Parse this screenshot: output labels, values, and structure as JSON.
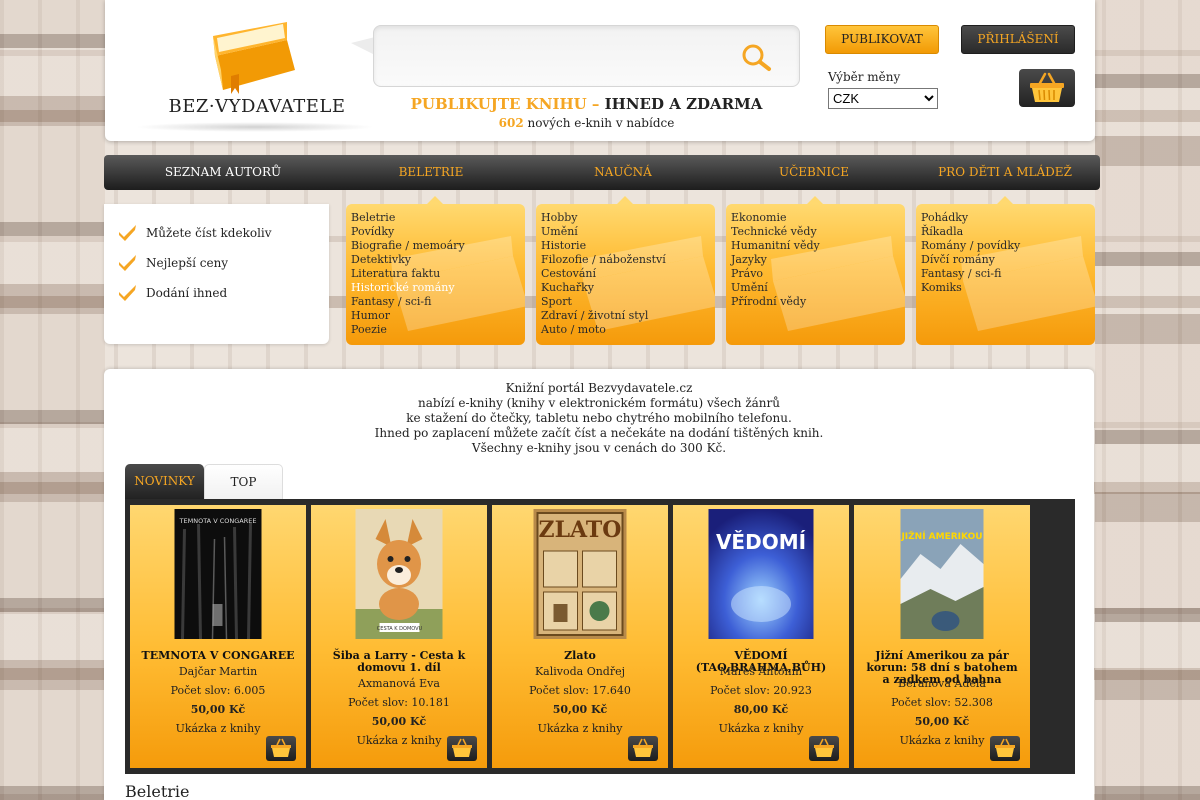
{
  "header": {
    "logo_text": "BEZ·VYDAVATELE",
    "search_placeholder": "",
    "tagline_orange": "PUBLIKUJTE KNIHU – ",
    "tagline_dark": "IHNED A ZDARMA",
    "new_count": "602",
    "new_text": " nových e-knih v nabídce",
    "publish_label": "PUBLIKOVAT",
    "login_label": "PŘIHLÁŠENÍ",
    "currency_label": "Výběr měny",
    "currency_value": "CZK"
  },
  "nav": {
    "items": [
      {
        "label": "SEZNAM AUTORŮ"
      },
      {
        "label": "BELETRIE"
      },
      {
        "label": "NAUČNÁ"
      },
      {
        "label": "UČEBNICE"
      },
      {
        "label": "PRO DĚTI A MLÁDEŽ"
      }
    ]
  },
  "features": [
    {
      "label": "Můžete číst kdekoliv"
    },
    {
      "label": "Nejlepší ceny"
    },
    {
      "label": "Dodání ihned"
    }
  ],
  "categories": [
    {
      "items": [
        "Beletrie",
        "Povídky",
        "Biografie / memoáry",
        "Detektivky",
        "Literatura faktu",
        "Historické romány",
        "Fantasy / sci-fi",
        "Humor",
        "Poezie"
      ]
    },
    {
      "items": [
        "Hobby",
        "Umění",
        "Historie",
        "Filozofie / náboženství",
        "Cestování",
        "Kuchařky",
        "Sport",
        "Zdraví / životní styl",
        "Auto / moto"
      ]
    },
    {
      "items": [
        "Ekonomie",
        "Technické vědy",
        "Humanitní vědy",
        "Jazyky",
        "Právo",
        "Umění",
        "Přírodní vědy"
      ]
    },
    {
      "items": [
        "Pohádky",
        "Říkadla",
        "Romány / povídky",
        "Dívčí romány",
        "Fantasy / sci-fi",
        "Komiks"
      ]
    }
  ],
  "intro": [
    "Knižní portál Bezvydavatele.cz",
    "nabízí e-knihy (knihy v elektronickém formátu) všech žánrů",
    "ke stažení do čtečky, tabletu nebo chytrého mobilního telefonu.",
    "Ihned po zaplacení můžete začít číst a nečekáte na dodání tištěných knih.",
    "Všechny e-knihy jsou v cenách do 300 Kč."
  ],
  "tabs": {
    "active": "NOVINKY",
    "inactive": "TOP"
  },
  "books": [
    {
      "title": "TEMNOTA V CONGAREE",
      "author": "Dajčar Martin",
      "words": "Počet slov: 6.005",
      "price": "50,00 Kč",
      "sample": "Ukázka z knihy",
      "cover_text": "TEMNOTA V CONGAREE"
    },
    {
      "title": "Šiba a Larry - Cesta k domovu 1. díl",
      "author": "Axmanová Eva",
      "words": "Počet slov: 10.181",
      "price": "50,00 Kč",
      "sample": "Ukázka z knihy",
      "cover_text": "CESTA K DOMOVU"
    },
    {
      "title": "Zlato",
      "author": "Kalivoda Ondřej",
      "words": "Počet slov: 17.640",
      "price": "50,00 Kč",
      "sample": "Ukázka z knihy",
      "cover_text": "ZLATO"
    },
    {
      "title": "VĚDOMÍ (TAO,BRAHMA,BŮH)",
      "author": "Mareš Antonín",
      "words": "Počet slov: 20.923",
      "price": "80,00 Kč",
      "sample": "Ukázka z knihy",
      "cover_text": "VĚDOMÍ"
    },
    {
      "title": "Jižní Amerikou za pár korun: 58 dní s batohem a zadkem od bahna",
      "author": "Beranová Adéla",
      "words": "Počet slov: 52.308",
      "price": "50,00 Kč",
      "sample": "Ukázka z knihy",
      "cover_text": "JIŽNÍ AMERIKOU"
    }
  ],
  "section_title": "Beletrie",
  "colors": {
    "accent": "#f5a623",
    "dark": "#222222"
  }
}
